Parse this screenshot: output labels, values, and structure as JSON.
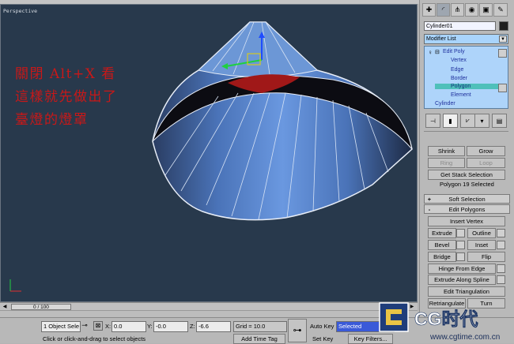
{
  "viewport": {
    "label": "Perspective",
    "overlay_lines": [
      "關閉 Alt+X 看",
      "這樣就先做出了",
      "臺燈的燈罩"
    ],
    "axis_y": "y",
    "axis_x": "x"
  },
  "command_panel": {
    "tabs": [
      "create-icon",
      "modify-icon",
      "hierarchy-icon",
      "motion-icon",
      "display-icon",
      "utilities-icon"
    ],
    "object_name": "Cylinder01",
    "object_color": "#1e1e1e",
    "modifier_list_label": "Modifier List",
    "stack": [
      {
        "label": "Edit Poly",
        "indent": 0
      },
      {
        "label": "Vertex",
        "indent": 1
      },
      {
        "label": "Edge",
        "indent": 1
      },
      {
        "label": "Border",
        "indent": 1
      },
      {
        "label": "Polygon",
        "indent": 1,
        "selected": true
      },
      {
        "label": "Element",
        "indent": 1
      },
      {
        "label": "Cylinder",
        "indent": 0
      }
    ],
    "selection": {
      "shrink": "Shrink",
      "grow": "Grow",
      "ring": "Ring",
      "loop": "Loop",
      "get_stack_selection": "Get Stack Selection",
      "status": "Polygon 19 Selected"
    },
    "soft_selection": {
      "toggle": "+",
      "title": "Soft Selection"
    },
    "edit_polygons": {
      "toggle": "-",
      "title": "Edit Polygons",
      "insert_vertex": "Insert Vertex",
      "extrude": "Extrude",
      "outline": "Outline",
      "bevel": "Bevel",
      "inset": "Inset",
      "bridge": "Bridge",
      "flip": "Flip",
      "hinge_from_edge": "Hinge From Edge",
      "extrude_along_spline": "Extrude Along Spline",
      "edit_triangulation": "Edit Triangulation",
      "retriangulate": "Retriangulate",
      "turn": "Turn"
    }
  },
  "timeline": {
    "slider": "0 / 100"
  },
  "status_bar": {
    "selection_count": "1 Object Sele",
    "x_label": "X:",
    "x_value": "0.0",
    "y_label": "Y:",
    "y_value": "-0.0",
    "z_label": "Z:",
    "z_value": "-6.6",
    "grid": "Grid = 10.0",
    "prompt": "Click or click-and-drag to select objects",
    "add_time_tag": "Add Time Tag",
    "auto_key": "Auto Key",
    "auto_key_select": "Selected",
    "set_key": "Set Key",
    "key_filters": "Key Filters..."
  },
  "watermark": {
    "logo": "CG时代",
    "url": "www.cgtime.com.cn"
  }
}
